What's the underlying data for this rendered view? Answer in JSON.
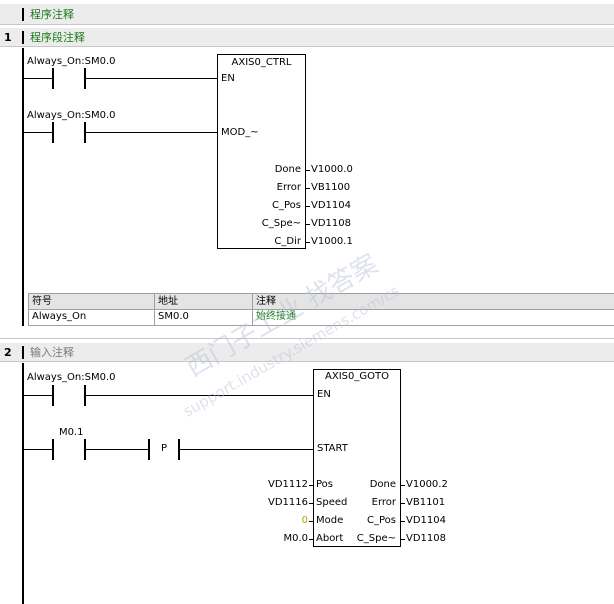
{
  "program_comment": "程序注释",
  "network1": {
    "number": "1",
    "comment": "程序段注释",
    "contact1": "Always_On:SM0.0",
    "contact2": "Always_On:SM0.0",
    "block": {
      "title": "AXIS0_CTRL",
      "in_en": "EN",
      "in_mod": "MOD_~",
      "outputs": [
        {
          "pin": "Done",
          "value": "V1000.0"
        },
        {
          "pin": "Error",
          "value": "VB1100"
        },
        {
          "pin": "C_Pos",
          "value": "VD1104"
        },
        {
          "pin": "C_Spe~",
          "value": "VD1108"
        },
        {
          "pin": "C_Dir",
          "value": "V1000.1"
        }
      ]
    },
    "symbol_table": {
      "headers": [
        "符号",
        "地址",
        "注释"
      ],
      "rows": [
        {
          "symbol": "Always_On",
          "address": "SM0.0",
          "comment": "始终接通"
        }
      ]
    }
  },
  "network2": {
    "number": "2",
    "comment": "输入注释",
    "contact1": "Always_On:SM0.0",
    "contact2": "M0.1",
    "p_label": "P",
    "block": {
      "title": "AXIS0_GOTO",
      "in_en": "EN",
      "in_start": "START",
      "inputs": [
        {
          "pin": "Pos",
          "value": "VD1112"
        },
        {
          "pin": "Speed",
          "value": "VD1116"
        },
        {
          "pin": "Mode",
          "value": "0"
        },
        {
          "pin": "Abort",
          "value": "M0.0"
        }
      ],
      "outputs": [
        {
          "pin": "Done",
          "value": "V1000.2"
        },
        {
          "pin": "Error",
          "value": "VB1101"
        },
        {
          "pin": "C_Pos",
          "value": "VD1104"
        },
        {
          "pin": "C_Spe~",
          "value": "VD1108"
        }
      ]
    }
  },
  "watermark": {
    "line1": "西门子工业 找答案",
    "line2": "support.industry.siemens.com/cs"
  },
  "colors": {
    "comment_green": "#1b7a1b",
    "comment_gray": "#7a7a7a",
    "mode_value": "#b8a000"
  }
}
